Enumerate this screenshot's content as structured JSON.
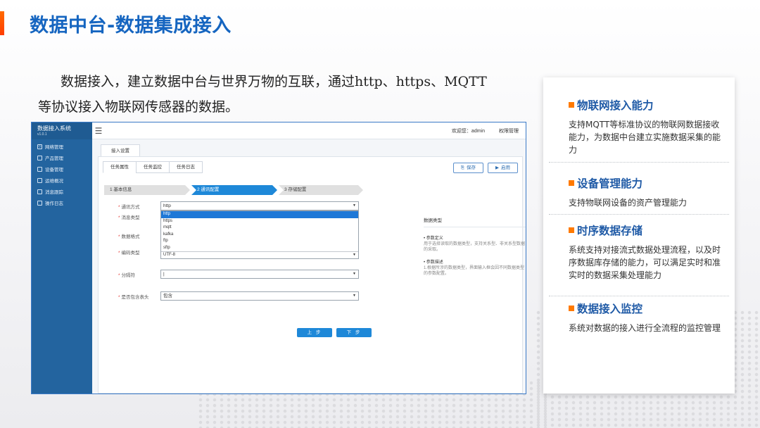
{
  "slide": {
    "title": "数据中台-数据集成接入",
    "intro_line1": "数据接入，建立数据中台与世界万物的互联，通过http、https、MQTT",
    "intro_line2": "等协议接入物联网传感器的数据。"
  },
  "app": {
    "brand": "数据接入系统",
    "version": "v1.0.1",
    "nav": [
      {
        "label": "网络管理",
        "icon": "grid-icon"
      },
      {
        "label": "产品管理",
        "icon": "box-icon"
      },
      {
        "label": "设备管理",
        "icon": "device-icon"
      },
      {
        "label": "运维概况",
        "icon": "chart-icon"
      },
      {
        "label": "消息跟踪",
        "icon": "message-icon"
      },
      {
        "label": "操作日志",
        "icon": "doc-icon"
      }
    ],
    "header": {
      "welcome": "欢迎您：admin",
      "permission": "权限管理"
    },
    "page_tab": "接入设置",
    "sub_tabs": [
      "任务属性",
      "任务监控",
      "任务日志"
    ],
    "actions": {
      "save": "保存",
      "start": "启用"
    },
    "steps": [
      "1  基本信息",
      "2 通讯配置",
      "3  存储配置"
    ],
    "form": {
      "protocol_label": "通讯方式",
      "protocol_value": "http",
      "protocol_options": [
        "http",
        "https",
        "mqtt",
        "kafka",
        "ftp",
        "sftp"
      ],
      "message_type_label": "消息类型",
      "data_format_label": "数据格式",
      "encoding_label": "编码类型",
      "encoding_value": "UTF-8",
      "separator_label": "分隔符",
      "separator_value": "|",
      "skip_header_label": "是否包含表头",
      "skip_header_value": "包含",
      "prev_button": "上 步",
      "next_button": "下 步"
    },
    "help": {
      "title": "数据类型",
      "sec1_title": "• 参数定义",
      "sec1_text": "用于选择读取的数据类型，支持关系型、非关系型数据的采取。",
      "sec2_title": "• 参数描述",
      "sec2_text": "1.根据所涉的数据类型，界面输入框会因不同数据类型的参数配置。"
    }
  },
  "cards": [
    {
      "title": "物联网接入能力",
      "body": "支持MQTT等标准协议的物联网数据接收能力，为数据中台建立实施数据采集的能力"
    },
    {
      "title": "设备管理能力",
      "body": "支持物联网设备的资产管理能力"
    },
    {
      "title": "时序数据存储",
      "body": "系统支持对接流式数据处理流程，以及时序数据库存储的能力，可以满足实时和准实时的数据采集处理能力"
    },
    {
      "title": "数据接入监控",
      "body": "系统对数据的接入进行全流程的监控管理"
    }
  ],
  "colors": {
    "title_blue": "#1565c0",
    "accent_orange": "#ff7a00",
    "sidebar_blue": "#23649f",
    "step_active": "#1e88d8"
  }
}
